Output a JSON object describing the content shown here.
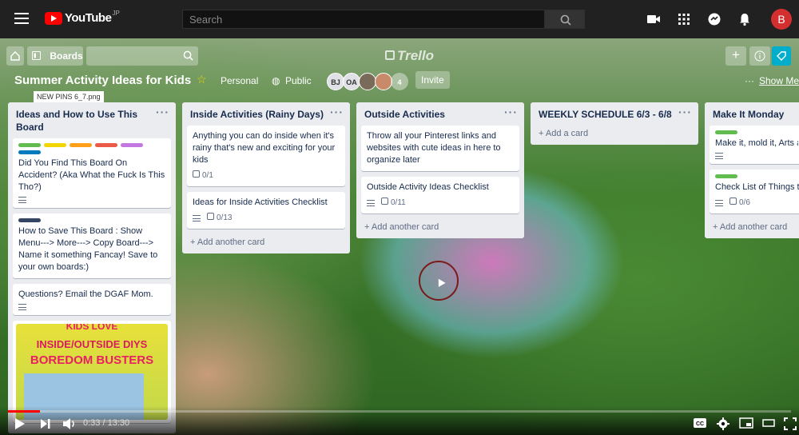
{
  "youtube": {
    "logo_text": "YouTube",
    "region": "JP",
    "search_placeholder": "Search",
    "avatar_letter": "B",
    "icons": [
      "menu-icon",
      "search-icon",
      "video-camera-icon",
      "apps-grid-icon",
      "chat-icon",
      "notifications-bell-icon"
    ]
  },
  "trello": {
    "boards_label": "Boards",
    "logo_text": "Trello",
    "board_title": "Summer Activity Ideas for Kids",
    "visibility_team": "Personal",
    "visibility": "Public",
    "members": [
      "BJ",
      "OA"
    ],
    "member_count": "4",
    "invite_label": "Invite",
    "show_menu_label": "Show Menu",
    "tooltip": "NEW PINS 6_7.png",
    "lists": [
      {
        "title": "Ideas and How to Use This Board",
        "cards": [
          {
            "text": "Did You Find This Board On Accident? (Aka What the Fuck Is This Tho?)",
            "labels": [
              "#61bd4f",
              "#f2d600",
              "#ff9f1a",
              "#eb5a46",
              "#c377e0",
              "#0079bf"
            ]
          },
          {
            "text": "How to Save This Board : Show Menu---> More---> Copy Board---> Name it something Fancay! Save to your own boards:)",
            "labels": [
              "#344563"
            ]
          },
          {
            "text": "Questions? Email the DGAF Mom.",
            "labels": []
          }
        ],
        "image_card_lines": [
          "KIDS LOVE",
          "INSIDE/OUTSIDE DIYS",
          "BOREDOM BUSTERS"
        ]
      },
      {
        "title": "Inside Activities (Rainy Days)",
        "cards": [
          {
            "text": "Anything you can do inside when it's rainy that's new and exciting for your kids",
            "checklist": "0/1"
          },
          {
            "text": "Ideas for Inside Activities Checklist",
            "checklist": "0/13"
          }
        ],
        "add_label": "Add another card"
      },
      {
        "title": "Outside Activities",
        "cards": [
          {
            "text": "Throw all your Pinterest links and websites with cute ideas in here to organize later"
          },
          {
            "text": "Outside Activity Ideas Checklist",
            "checklist": "0/11"
          }
        ],
        "add_label": "Add another card"
      },
      {
        "title": "WEEKLY SCHEDULE 6/3 - 6/8",
        "add_label": "Add a card"
      },
      {
        "title": "Make It Monday",
        "cards": [
          {
            "text": "Make it, mold it, Arts a Doh, and everything in Ideas for what to Make"
          },
          {
            "text": "Check List of Things t",
            "checklist": "0/6"
          }
        ],
        "add_label": "Add another card"
      }
    ]
  },
  "player": {
    "current_time": "0:33",
    "duration": "13:30",
    "time_display": "0:33 / 13:30",
    "progress": 0.041,
    "icons": [
      "play-icon",
      "next-icon",
      "volume-icon",
      "subtitles-icon",
      "settings-gear-icon",
      "miniplayer-icon",
      "theater-mode-icon",
      "fullscreen-icon"
    ]
  }
}
